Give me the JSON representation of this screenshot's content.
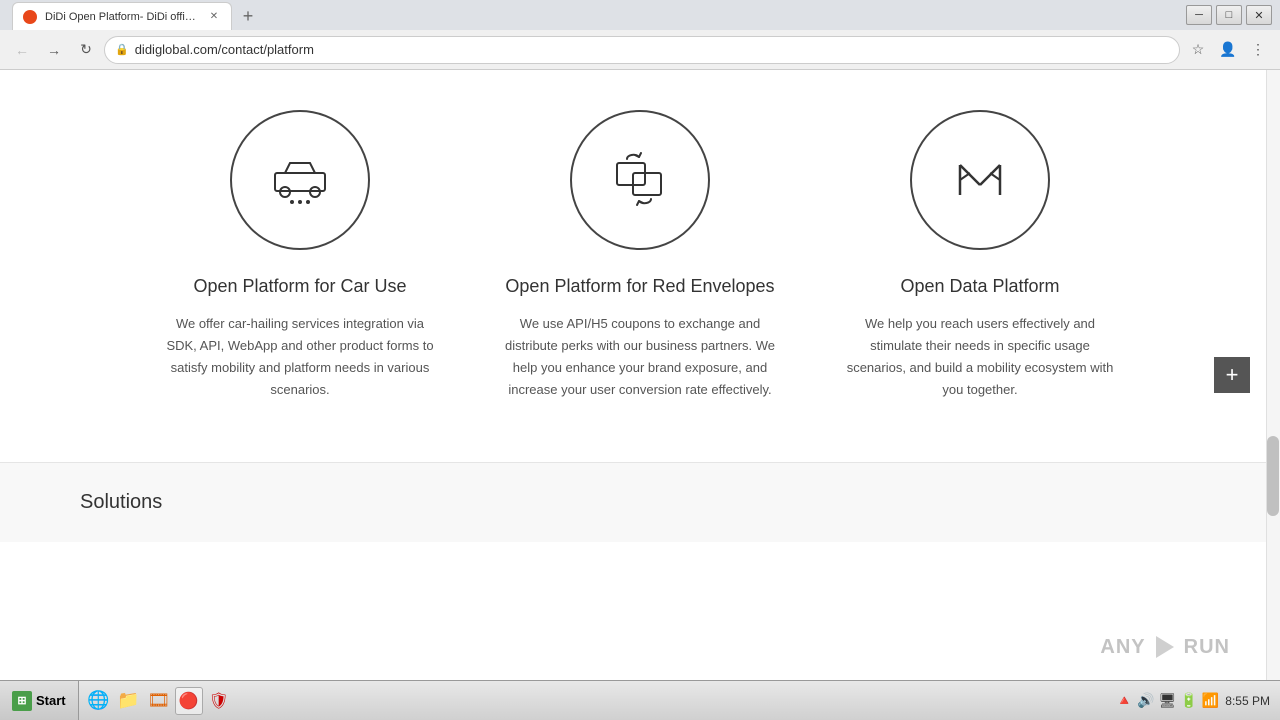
{
  "browser": {
    "title": "DiDi Open Platform- DiDi official web...",
    "url": "didiglobal.com/contact/platform",
    "tab_label": "DiDi Open Platform- DiDi official web...",
    "favicon_color": "#e8471a"
  },
  "nav": {
    "back_icon": "←",
    "forward_icon": "→",
    "refresh_icon": "↻",
    "new_tab_icon": "+",
    "bookmark_icon": "☆",
    "account_icon": "👤",
    "menu_icon": "⋮"
  },
  "window_controls": {
    "minimize": "─",
    "maximize": "□",
    "close": "✕"
  },
  "cards": [
    {
      "id": "car-platform",
      "title": "Open Platform for Car Use",
      "description": "We offer car-hailing services integration via SDK, API, WebApp and other product forms to satisfy mobility and platform needs in various scenarios.",
      "icon": "car"
    },
    {
      "id": "red-envelopes",
      "title": "Open Platform for Red Envelopes",
      "description": "We use API/H5 coupons to exchange and distribute perks with our business partners. We help you enhance your brand exposure, and increase your user conversion rate effectively.",
      "icon": "envelopes"
    },
    {
      "id": "data-platform",
      "title": "Open Data Platform",
      "description": "We help you reach users effectively and stimulate their needs in specific usage scenarios, and build a mobility ecosystem with you together.",
      "icon": "data"
    }
  ],
  "footer": {
    "solutions_label": "Solutions"
  },
  "plus_button_label": "+",
  "taskbar": {
    "start_label": "Start",
    "time": "8:55 PM",
    "active_tab": "Chrome"
  }
}
